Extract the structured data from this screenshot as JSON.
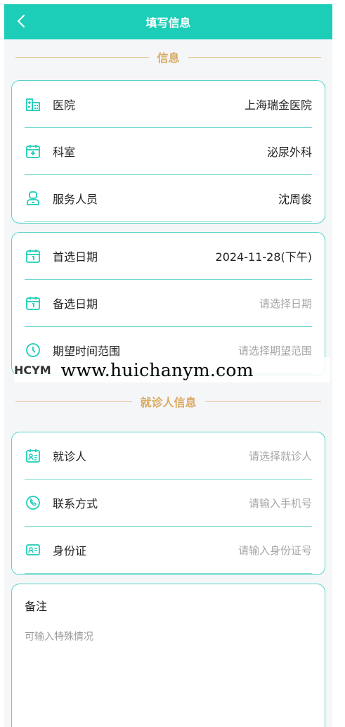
{
  "header": {
    "title": "填写信息",
    "back_icon": "chevron-left-icon"
  },
  "section_info": {
    "title": "信息"
  },
  "card_basic": {
    "hospital": {
      "label": "医院",
      "value": "上海瑞金医院",
      "icon": "hospital-icon"
    },
    "department": {
      "label": "科室",
      "value": "泌尿外科",
      "icon": "calendar-plus-icon"
    },
    "staff": {
      "label": "服务人员",
      "value": "沈周俊",
      "icon": "person-icon"
    }
  },
  "card_dates": {
    "first_date": {
      "label": "首选日期",
      "value": "2024-11-28(下午)",
      "icon": "calendar-icon"
    },
    "second_date": {
      "label": "备选日期",
      "placeholder": "请选择日期",
      "icon": "calendar-icon"
    },
    "time_range": {
      "label": "期望时间范围",
      "placeholder": "请选择期望范围",
      "icon": "clock-icon"
    }
  },
  "watermark": {
    "logo": "HCYM",
    "url": "www.huichanym.com"
  },
  "section_patient": {
    "title": "就诊人信息"
  },
  "card_patient": {
    "patient": {
      "label": "就诊人",
      "placeholder": "请选择就诊人",
      "icon": "id-card-calendar-icon"
    },
    "contact": {
      "label": "联系方式",
      "placeholder": "请输入手机号",
      "icon": "phone-icon"
    },
    "id_card": {
      "label": "身份证",
      "placeholder": "请输入身份证号",
      "icon": "id-card-icon"
    }
  },
  "notes": {
    "title": "备注",
    "placeholder": "可输入特殊情况"
  },
  "colors": {
    "primary": "#1ccdb8",
    "border": "#58d4c6",
    "gold": "#d9aa62"
  }
}
